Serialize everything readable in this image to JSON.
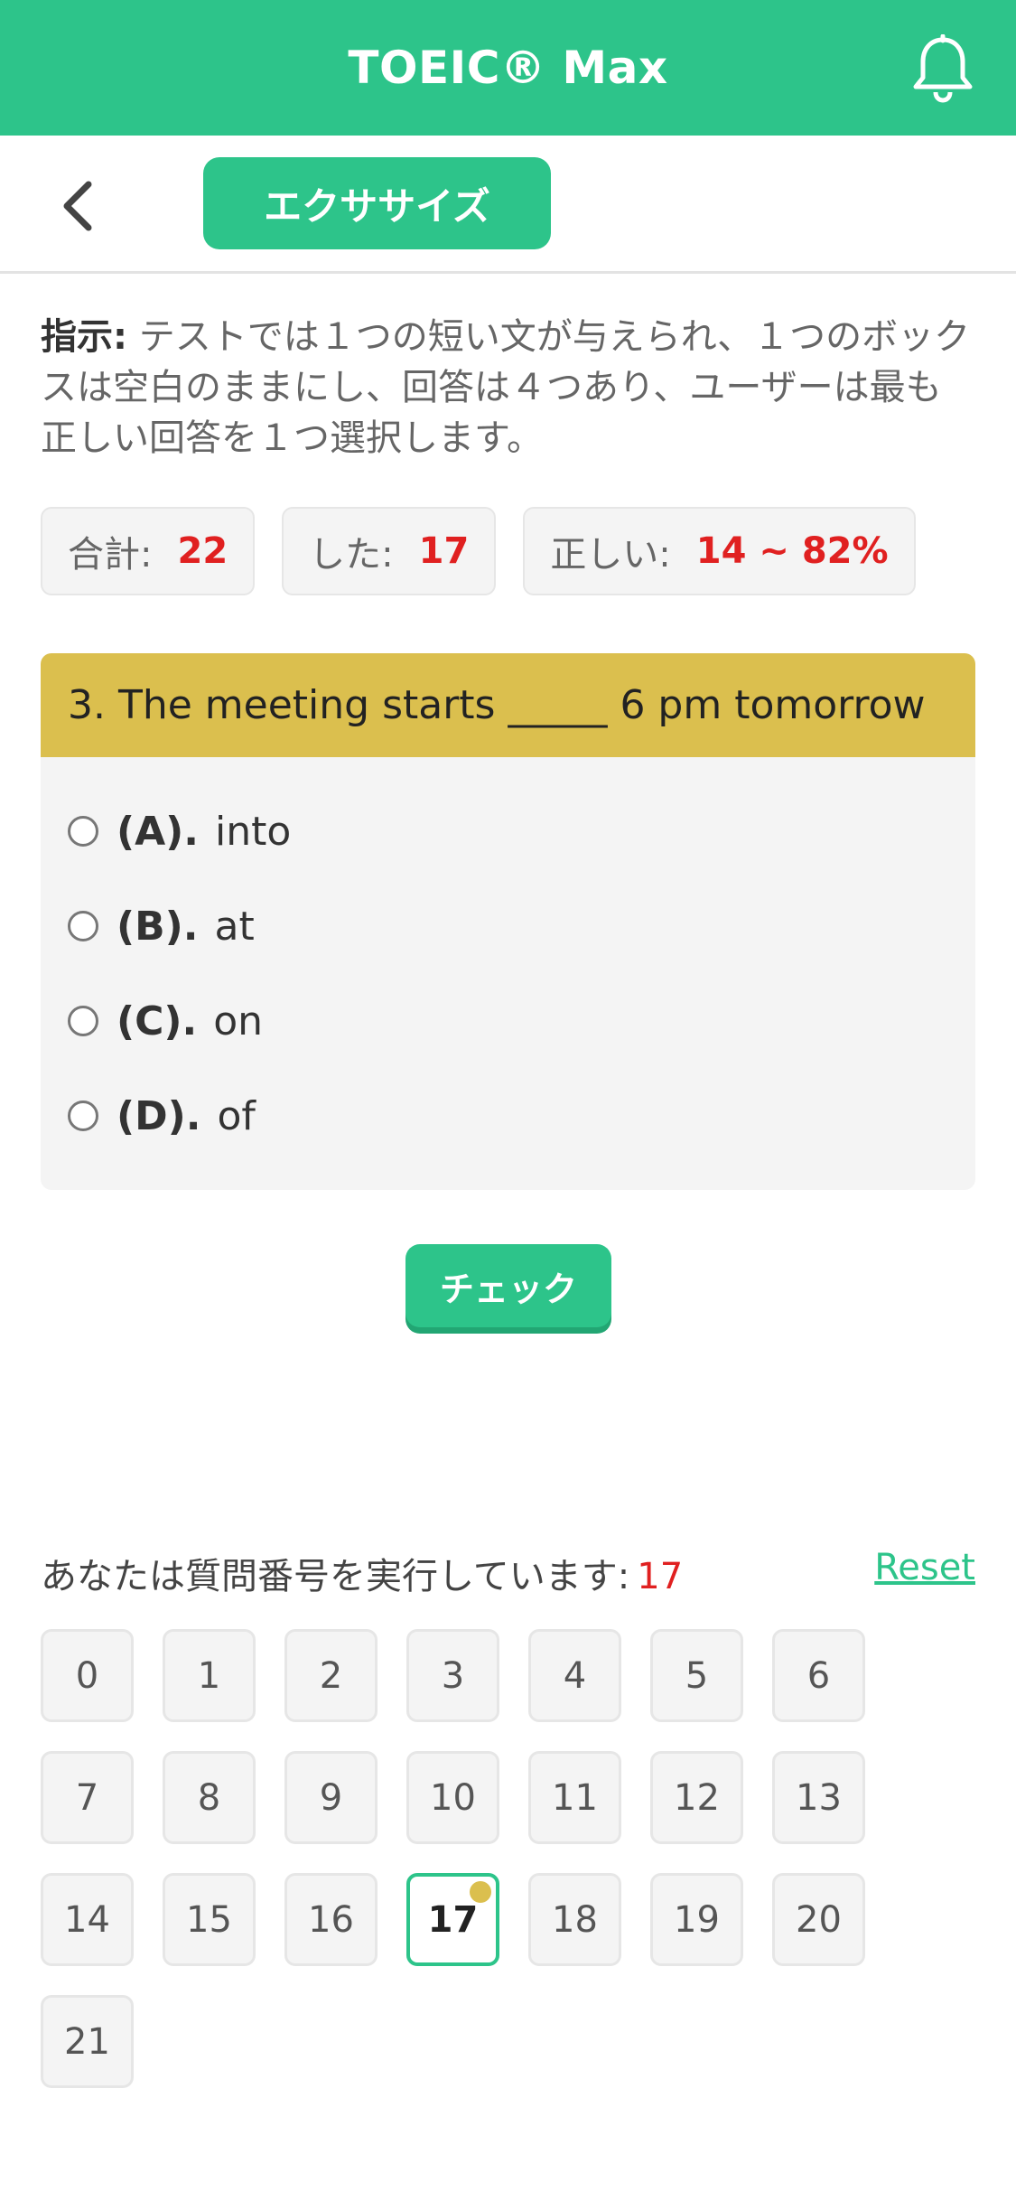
{
  "header": {
    "title": "TOEIC® Max"
  },
  "subheader": {
    "tab_label": "エクササイズ"
  },
  "instructions": {
    "label": "指示:",
    "text": " テストでは１つの短い文が与えられ、１つのボックスは空白のままにし、回答は４つあり、ユーザーは最も正しい回答を１つ選択します。"
  },
  "stats": {
    "total_label": "合計:",
    "total_value": "22",
    "done_label": "した:",
    "done_value": "17",
    "correct_label": "正しい:",
    "correct_value": "14 ~ 82%"
  },
  "question": {
    "text": "3. The meeting starts _____ 6 pm tomorrow",
    "options": [
      {
        "letter": "(A).",
        "text": "into"
      },
      {
        "letter": "(B).",
        "text": "at"
      },
      {
        "letter": "(C).",
        "text": "on"
      },
      {
        "letter": "(D).",
        "text": "of"
      }
    ]
  },
  "check_label": "チェック",
  "progress": {
    "label": "あなたは質問番号を実行しています:",
    "current": "17",
    "reset_label": "Reset"
  },
  "grid": [
    "0",
    "1",
    "2",
    "3",
    "4",
    "5",
    "6",
    "7",
    "8",
    "9",
    "10",
    "11",
    "12",
    "13",
    "14",
    "15",
    "16",
    "17",
    "18",
    "19",
    "20",
    "21"
  ],
  "colors": {
    "accent": "#2dc48a",
    "question_bar": "#dbbf4e",
    "highlight": "#e02020"
  },
  "icons": {
    "notification": "bell-icon",
    "back": "chevron-left-icon"
  }
}
